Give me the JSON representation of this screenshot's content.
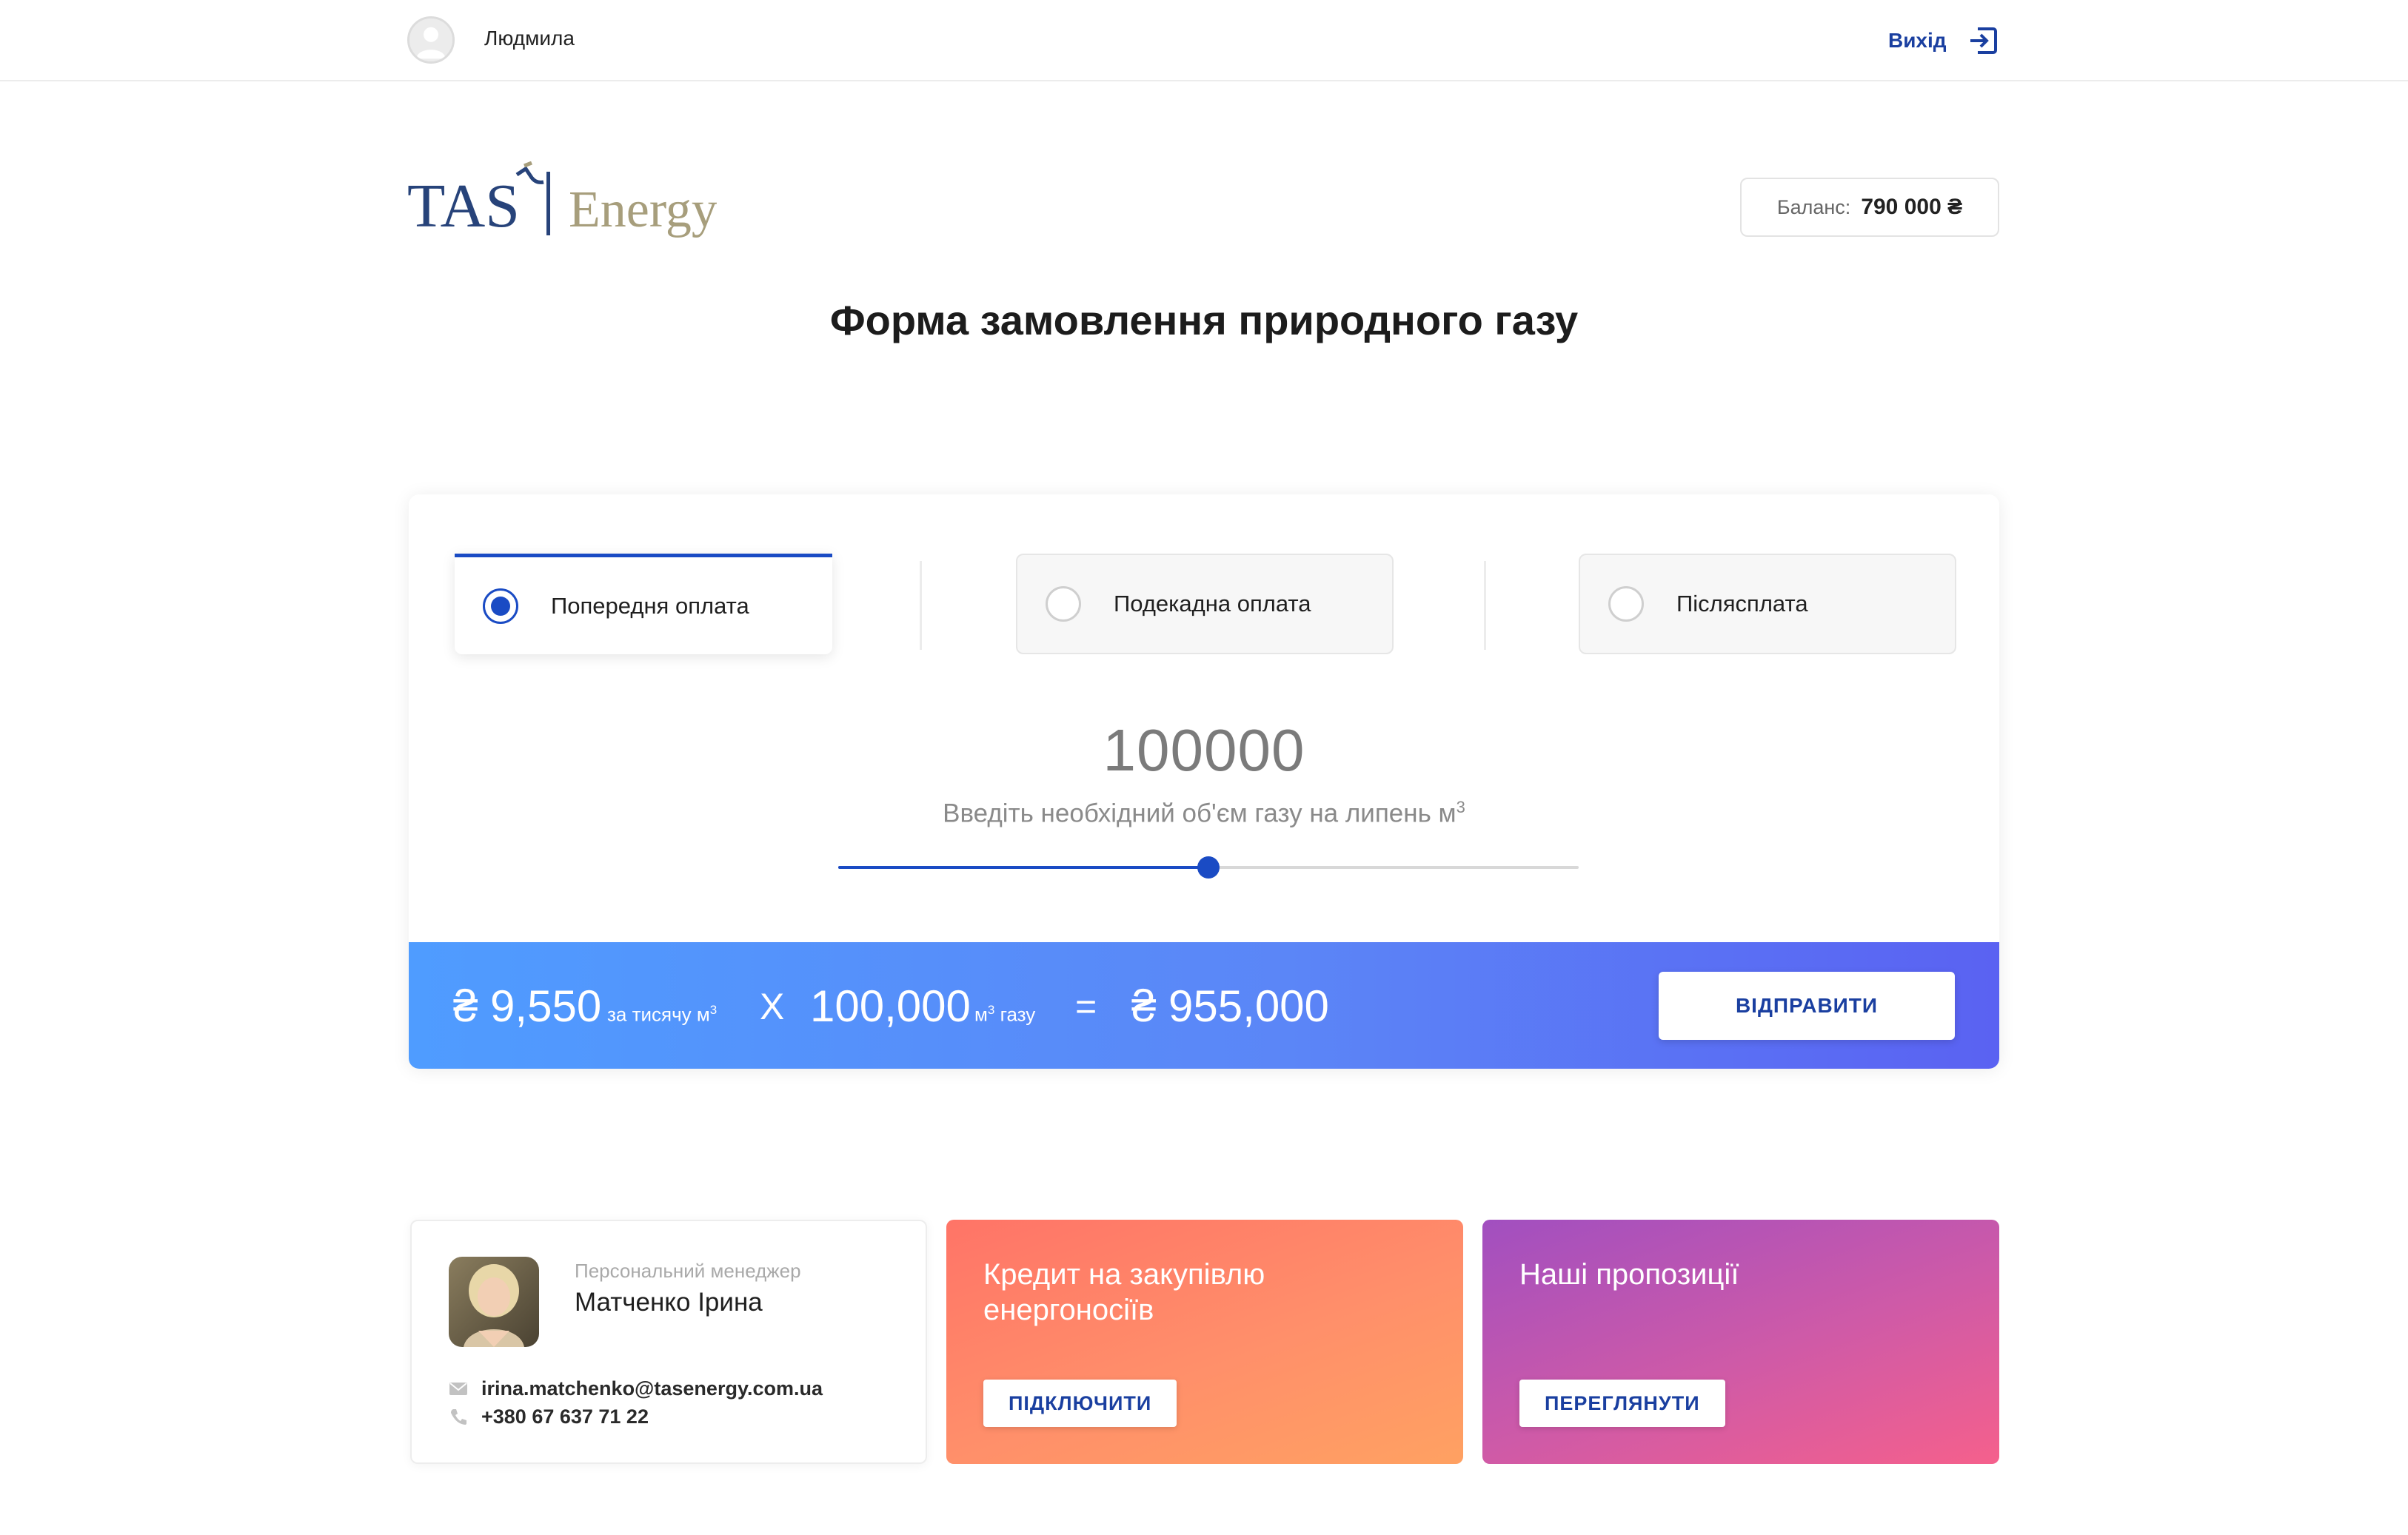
{
  "header": {
    "user_name": "Людмила",
    "logout_label": "Вихід"
  },
  "logo": {
    "brand": "TAS",
    "product": "Energy"
  },
  "balance": {
    "label": "Баланс:",
    "value": "790 000 ₴"
  },
  "page_title": "Форма замовлення природного газу",
  "payment_options": [
    {
      "label": "Попередня оплата",
      "selected": true
    },
    {
      "label": "Подекадна оплата",
      "selected": false
    },
    {
      "label": "Післясплата",
      "selected": false
    }
  ],
  "volume": {
    "value": "100000",
    "caption": "Введіть необхідний об'єм газу на липень м",
    "caption_unit_sup": "3",
    "slider_fraction": 0.5
  },
  "calculation": {
    "price": "₴ 9,550",
    "price_unit": "за тисячу м",
    "price_unit_sup": "3",
    "multiply": "X",
    "amount": "100,000",
    "amount_unit_prefix": "м",
    "amount_unit_sup": "3",
    "amount_unit_suffix": "газу",
    "equals": "=",
    "total": "₴ 955,000",
    "submit_label": "ВІДПРАВИТИ"
  },
  "manager": {
    "role": "Персональний менеджер",
    "name": "Матченко Ірина",
    "email": "irina.matchenko@tasenergy.com.ua",
    "phone": "+380 67 637 71 22"
  },
  "promos": [
    {
      "title": "Кредит на закупівлю енергоносіїв",
      "button": "ПІДКЛЮЧИТИ"
    },
    {
      "title": "Наші пропозиції",
      "button": "ПЕРЕГЛЯНУТИ"
    }
  ],
  "colors": {
    "accent": "#1a4bc4",
    "link": "#1a3fa0",
    "calc_bar_start": "#4f9cff",
    "calc_bar_end": "#5a62f2",
    "promo_credit": "#ff8a68",
    "promo_offers": "#c65aa8",
    "logo_navy": "#27437a",
    "logo_gold": "#a79e7c"
  }
}
